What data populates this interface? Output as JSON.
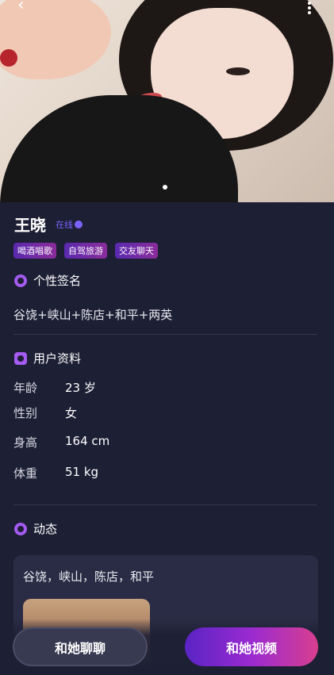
{
  "profile": {
    "name": "王晓",
    "status": "在线",
    "tags": [
      "喝酒唱歌",
      "自驾旅游",
      "交友聊天"
    ]
  },
  "signature_section": {
    "title": "个性签名",
    "text": "谷饶+峡山+陈店+和平+两英"
  },
  "info_section": {
    "title": "用户资料",
    "rows": [
      {
        "label": "年龄",
        "value": "23 岁"
      },
      {
        "label": "性别",
        "value": "女"
      },
      {
        "label": "身高",
        "value": "164 cm"
      },
      {
        "label": "体重",
        "value": "51 kg"
      }
    ]
  },
  "moments_section": {
    "title": "动态",
    "post_text": "谷饶，峡山，陈店，和平"
  },
  "actions": {
    "chat_label": "和她聊聊",
    "video_label": "和她视频"
  },
  "gallery": {
    "current_page": 1,
    "total_pages": 1
  },
  "colors": {
    "background": "#1d1f34",
    "accent": "#7c63ff",
    "video_gradient_start": "#5a24c4",
    "video_gradient_end": "#d83f8f"
  }
}
